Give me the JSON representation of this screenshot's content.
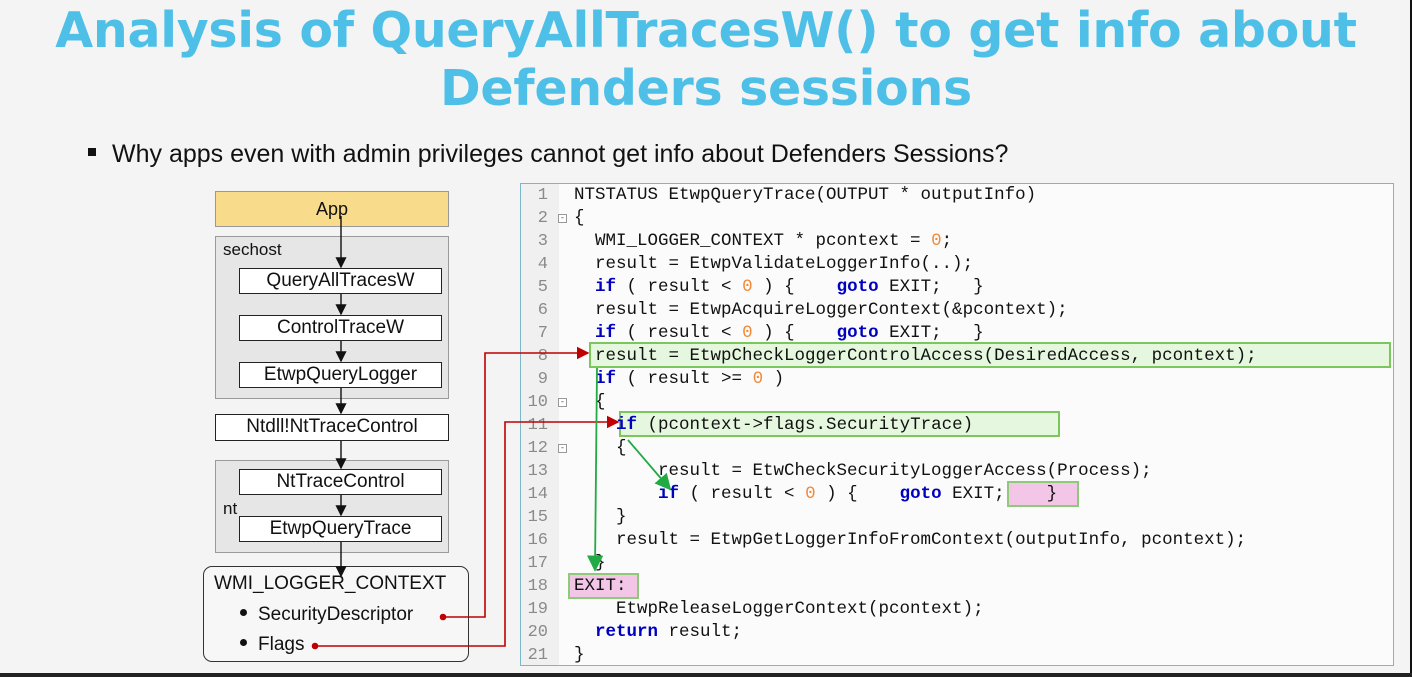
{
  "title": {
    "line1": "Analysis of QueryAllTracesW() to get info about",
    "line2": "Defenders sessions"
  },
  "bullet": "Why apps even with admin privileges cannot get info about Defenders Sessions?",
  "diagram": {
    "app": "App",
    "sechost_label": "sechost",
    "sechost_functions": [
      "QueryAllTracesW",
      "ControlTraceW",
      "EtwpQueryLogger"
    ],
    "ntdll": "Ntdll!NtTraceControl",
    "nt_label": "nt",
    "nt_functions": [
      "NtTraceControl",
      "EtwpQueryTrace"
    ],
    "context": {
      "title": "WMI_LOGGER_CONTEXT",
      "items": [
        "SecurityDescriptor",
        "Flags"
      ]
    }
  },
  "code": {
    "line_numbers": [
      "1",
      "2",
      "3",
      "4",
      "5",
      "6",
      "7",
      "8",
      "9",
      "10",
      "11",
      "12",
      "13",
      "14",
      "15",
      "16",
      "17",
      "18",
      "19",
      "20",
      "21"
    ],
    "l1": [
      "NTSTATUS EtwpQueryTrace(OUTPUT * outputInfo)"
    ],
    "l2": [
      "{"
    ],
    "l3": [
      "  WMI_LOGGER_CONTEXT * pcontext = ",
      "0",
      ";"
    ],
    "l4": [
      "  result = EtwpValidateLoggerInfo(..);"
    ],
    "l5": [
      "  ",
      "if",
      " ( result < ",
      "0",
      " ) {    ",
      "goto",
      " EXIT;   }"
    ],
    "l6": [
      "  result = EtwpAcquireLoggerContext(&pcontext);"
    ],
    "l7": [
      "  ",
      "if",
      " ( result < ",
      "0",
      " ) {    ",
      "goto",
      " EXIT;   }"
    ],
    "l8": [
      "  result = EtwpCheckLoggerControlAccess(DesiredAccess, pcontext);"
    ],
    "l9": [
      "  ",
      "if",
      " ( result >= ",
      "0",
      " )"
    ],
    "l10": [
      "  {"
    ],
    "l11": [
      "    ",
      "if",
      " (pcontext->flags.SecurityTrace)"
    ],
    "l12": [
      "    {"
    ],
    "l13": [
      "        result = EtwCheckSecurityLoggerAccess(Process);"
    ],
    "l14": [
      "        ",
      "if",
      " ( result < ",
      "0",
      " ) {    ",
      "goto",
      " EXIT;    }"
    ],
    "l15": [
      "    }"
    ],
    "l16": [
      "    result = EtwpGetLoggerInfoFromContext(outputInfo, pcontext);"
    ],
    "l17": [
      "  }"
    ],
    "l18": [
      "EXIT:"
    ],
    "l19": [
      "    EtwpReleaseLoggerContext(pcontext);"
    ],
    "l20": [
      "  ",
      "return",
      " result;"
    ],
    "l21": [
      "}"
    ]
  },
  "colors": {
    "title": "#4ec0e8",
    "app_box": "#f8dc8b",
    "keyword": "#0000c0",
    "number": "#ef8a3a",
    "green_highlight": "#7cc65e",
    "pink_highlight": "#f3c6e8",
    "red_connector": "#c00000",
    "green_arrow": "#22aa44"
  }
}
